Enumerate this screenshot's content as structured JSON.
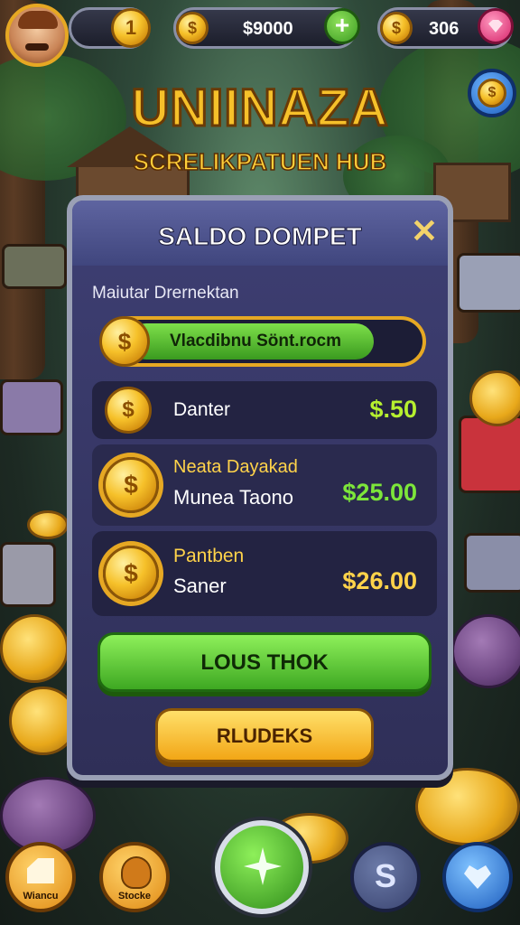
{
  "hud": {
    "level": "1",
    "coin_balance": "$9000",
    "gems": "306",
    "add_label": "+",
    "coin_symbol": "$"
  },
  "header": {
    "title": "UNIINAZA",
    "subtitle": "SCRELIKPATUEN HUB"
  },
  "wallet": {
    "title": "SALDO DOMPET",
    "close_label": "✕",
    "subtitle": "Maiutar Drernektan",
    "wallet_bar_text": "Vlacdibnu Sönt.rocm",
    "rows": [
      {
        "line1": "",
        "line2": "Danter",
        "amount": "$.50",
        "amount_color": "#b6f02f"
      },
      {
        "line1": "Neata Dayakad",
        "line2": "Munea Taono",
        "amount": "$25.00",
        "amount_color": "#7de63a"
      },
      {
        "line1": "Pantben",
        "line2": "Saner",
        "amount": "$26.00",
        "amount_color": "#ffd34a"
      }
    ],
    "primary_button": "LOUS THOK",
    "secondary_button": "RLUDEKS"
  },
  "bottom_nav": {
    "left1_label": "Wiancu",
    "left2_label": "Stocke",
    "coin_symbol": "S"
  },
  "colors": {
    "gold": "#f6c12a",
    "green": "#4fc42b",
    "panel": "#3e3f73"
  }
}
